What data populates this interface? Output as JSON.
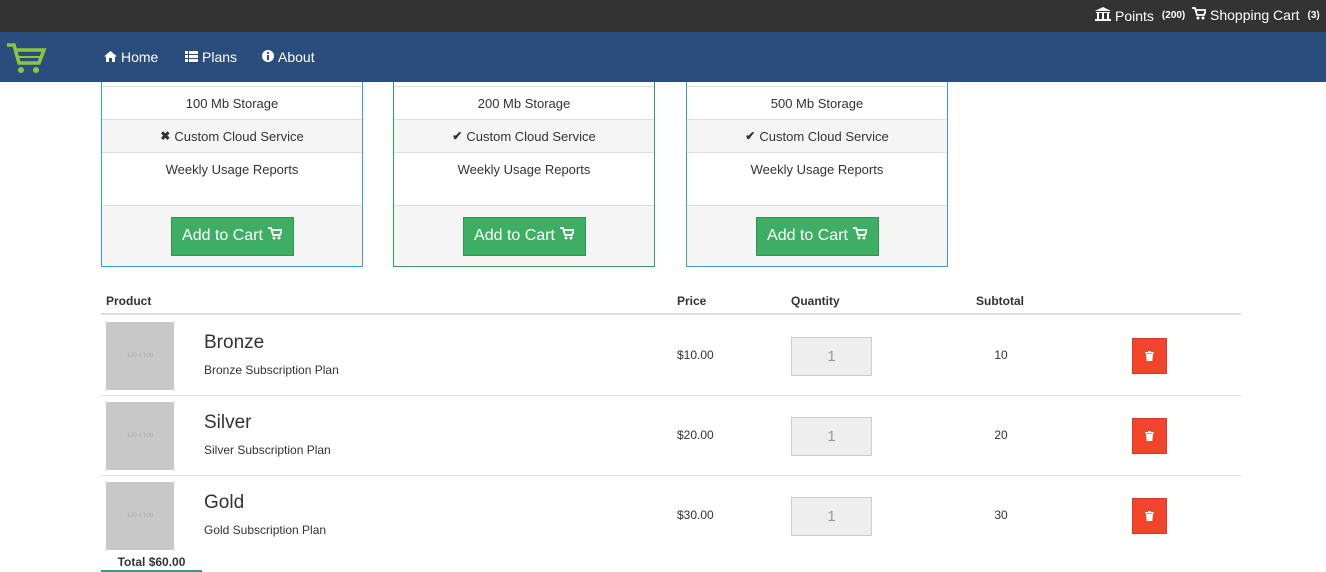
{
  "topbar": {
    "points_label": "Points",
    "points_count": "(200)",
    "cart_label": "Shopping Cart",
    "cart_count": "(3)"
  },
  "navbar": {
    "items": [
      {
        "label": "Home",
        "icon": "home-icon"
      },
      {
        "label": "Plans",
        "icon": "list-icon"
      },
      {
        "label": "About",
        "icon": "info-icon"
      }
    ]
  },
  "plans": [
    {
      "storage": "100 Mb Storage",
      "custom_cloud": "Custom Cloud Service",
      "custom_cloud_included": false,
      "reports": "Weekly Usage Reports",
      "button": "Add to Cart"
    },
    {
      "storage": "200 Mb Storage",
      "custom_cloud": "Custom Cloud Service",
      "custom_cloud_included": true,
      "reports": "Weekly Usage Reports",
      "button": "Add to Cart"
    },
    {
      "storage": "500 Mb Storage",
      "custom_cloud": "Custom Cloud Service",
      "custom_cloud_included": true,
      "reports": "Weekly Usage Reports",
      "button": "Add to Cart"
    }
  ],
  "cart": {
    "headers": {
      "product": "Product",
      "price": "Price",
      "quantity": "Quantity",
      "subtotal": "Subtotal"
    },
    "rows": [
      {
        "thumb": "100 x 100",
        "name": "Bronze",
        "desc": "Bronze Subscription Plan",
        "price": "$10.00",
        "qty": "1",
        "subtotal": "10"
      },
      {
        "thumb": "100 x 100",
        "name": "Silver",
        "desc": "Silver Subscription Plan",
        "price": "$20.00",
        "qty": "1",
        "subtotal": "20"
      },
      {
        "thumb": "100 x 100",
        "name": "Gold",
        "desc": "Gold Subscription Plan",
        "price": "$30.00",
        "qty": "1",
        "subtotal": "30"
      }
    ],
    "total": "Total $60.00"
  },
  "colors": {
    "topbar": "#333333",
    "navbar": "#2b4d7d",
    "add_button": "#3dae64",
    "delete_button": "#f0452c",
    "logo": "#8cc63f"
  }
}
